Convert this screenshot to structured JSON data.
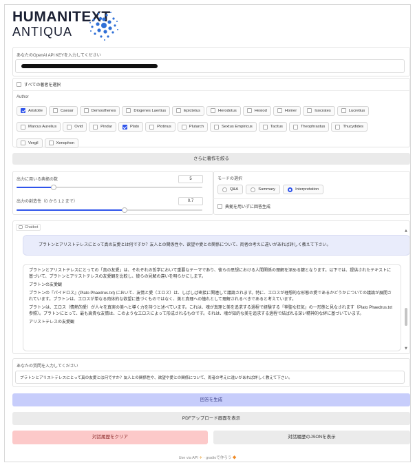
{
  "logo": {
    "line1": "HUMANITEXT",
    "line2": "ANTIQUA"
  },
  "api_key": {
    "label": "あなたのOpenAI API KEYを入力してください"
  },
  "select_all": {
    "label": "すべての著者を選択",
    "checked": false
  },
  "authors": {
    "label": "Author",
    "items": [
      {
        "label": "Aristotle",
        "checked": true
      },
      {
        "label": "Caesar",
        "checked": false
      },
      {
        "label": "Demosthenes",
        "checked": false
      },
      {
        "label": "Diogenes Laertius",
        "checked": false
      },
      {
        "label": "Epictetus",
        "checked": false
      },
      {
        "label": "Herodotus",
        "checked": false
      },
      {
        "label": "Hesiod",
        "checked": false
      },
      {
        "label": "Homer",
        "checked": false
      },
      {
        "label": "Isocrates",
        "checked": false
      },
      {
        "label": "Lucretius",
        "checked": false
      },
      {
        "label": "Marcus Aurelius",
        "checked": false
      },
      {
        "label": "Ovid",
        "checked": false
      },
      {
        "label": "Pindar",
        "checked": false
      },
      {
        "label": "Plato",
        "checked": true
      },
      {
        "label": "Plotinus",
        "checked": false
      },
      {
        "label": "Plutarch",
        "checked": false
      },
      {
        "label": "Sextus Empiricus",
        "checked": false
      },
      {
        "label": "Tacitus",
        "checked": false
      },
      {
        "label": "Theophrastus",
        "checked": false
      },
      {
        "label": "Thucydides",
        "checked": false
      },
      {
        "label": "Vergil",
        "checked": false
      },
      {
        "label": "Xenophon",
        "checked": false
      }
    ]
  },
  "narrow_button": "さらに著作を絞る",
  "sliders": {
    "count": {
      "label": "出力に用いる典拠の数",
      "value": "5",
      "fraction": 0.2
    },
    "temp": {
      "label": "出力の創造性（0 から 1.2 まで）",
      "value": "0.7",
      "fraction": 0.58
    }
  },
  "mode": {
    "label": "モードの選択",
    "options": [
      {
        "label": "Q&A",
        "selected": false
      },
      {
        "label": "Summary",
        "selected": false
      },
      {
        "label": "Interpretation",
        "selected": true
      }
    ],
    "no_source_label": "典拠を用いずに回答生成"
  },
  "chatbot": {
    "label": "Chatbot",
    "user_message": "プラトンとアリストテレスにとって真の友愛とは何ですか？友人との関係性や、欲望や愛との関係について、両者の考えに違いがあれば詳しく教えて下さい。",
    "bot_paragraphs": [
      "プラトンとアリストテレスにとっての「真の友愛」は、それぞれの哲学において重要なテーマであり、彼らの思想における人間関係の理解を深める鍵となります。以下では、提供されたテキストに基づいて、プラトンとアリストテレスの友愛観を比較し、彼らの見解の違いを明らかにします。",
      "プラトンの友愛観",
      "プラトンの『パイドロス』(Plato Phaedrus.txt) において、友情と愛（エロス）は、しばしば密接に関連して議論されます。特に、エロスが理想的な形態の愛であるかどうかについての議論が展開されています。プラトンは、エロスが単なる肉体的な欲望に基づくものではなく、美と真理への憧れとして理解されるべきであると考えています。",
      "プラトンは、エロス（情熱的愛）が人々を真実の美へと導く力を持つと述べています。これは、魂が真理と美を追求する過程で経験する「神聖な狂気」の一形態と見なされます（Plato Phaedrus.txt参照）。プラトンにとって、最も高貴な友情は、このようなエロスによって形成されるものです。それは、魂が知的な美を追求する過程で結ばれる深い精神的な絆に基づいています。",
      "アリストテレスの友愛観"
    ]
  },
  "question": {
    "label": "あなたの質問を入力してください",
    "value": "プラトンとアリストテレスにとって真の友愛とは何ですか？友人との関係性や、欲望や愛との関係について、両者の考えに違いがあれば詳しく教えて下さい。"
  },
  "buttons": {
    "generate": "回答を生成",
    "pdf": "PDFアップロード画面を表示",
    "clear": "対話履歴をクリア",
    "json": "対話履歴のJSONを表示"
  },
  "footer": {
    "api": "Use via API",
    "sep": "·",
    "gradio": "gradioで作ろう"
  },
  "colors": {
    "accent": "#2f54eb",
    "generate_bg": "#c7cdfb",
    "clear_bg": "#fcc9c9"
  }
}
